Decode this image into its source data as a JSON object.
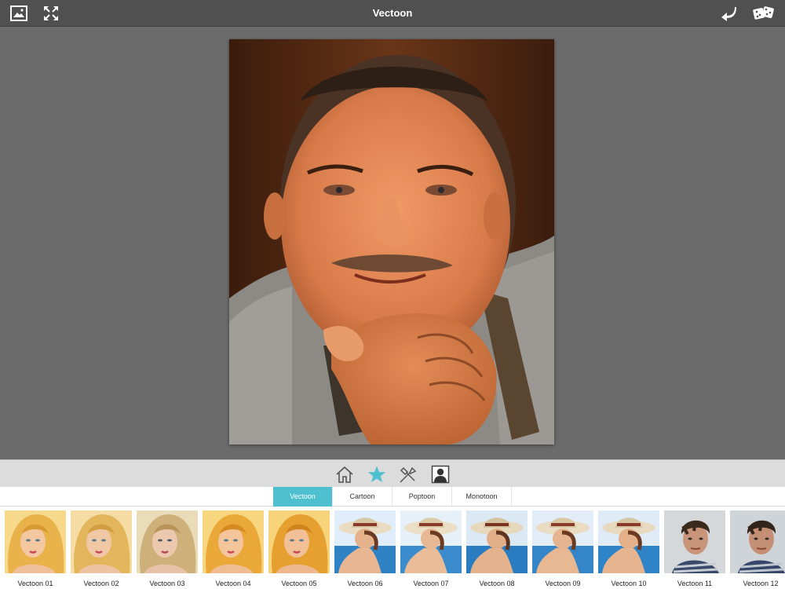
{
  "app": {
    "title": "Vectoon"
  },
  "topbar": {
    "left_icons": [
      "image-frame-icon",
      "expand-arrows-icon"
    ],
    "right_icons": [
      "undo-arrow-icon",
      "dice-icon"
    ]
  },
  "toolbar": {
    "icons": [
      "home-icon",
      "star-icon",
      "tools-icon",
      "portrait-icon"
    ],
    "active": "star-icon"
  },
  "tabs": [
    {
      "label": "Vectoon",
      "active": true
    },
    {
      "label": "Cartoon",
      "active": false
    },
    {
      "label": "Poptoon",
      "active": false
    },
    {
      "label": "Monotoon",
      "active": false
    }
  ],
  "thumbnails": [
    {
      "label": "Vectoon 01"
    },
    {
      "label": "Vectoon 02"
    },
    {
      "label": "Vectoon 03"
    },
    {
      "label": "Vectoon 04"
    },
    {
      "label": "Vectoon 05"
    },
    {
      "label": "Vectoon 06"
    },
    {
      "label": "Vectoon 07"
    },
    {
      "label": "Vectoon 08"
    },
    {
      "label": "Vectoon 09"
    },
    {
      "label": "Vectoon 10"
    },
    {
      "label": "Vectoon 11"
    },
    {
      "label": "Vectoon 12"
    }
  ],
  "colors": {
    "accent": "#4fc0cf",
    "topbar": "#505050",
    "canvas": "#6b6b6b"
  }
}
